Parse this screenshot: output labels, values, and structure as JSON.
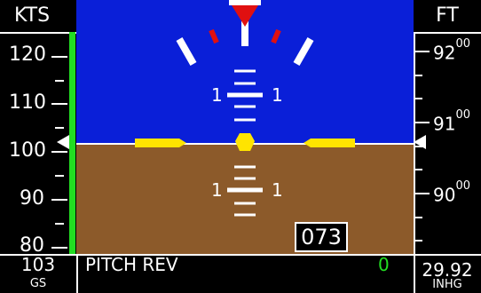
{
  "speed": {
    "unit": "KTS",
    "labels": [
      "120",
      "110",
      "100",
      "90",
      "80"
    ],
    "value": "103",
    "sub": "GS"
  },
  "altitude": {
    "unit": "FT",
    "labels": [
      {
        "hi": "92",
        "lo": "00"
      },
      {
        "hi": "91",
        "lo": "00"
      },
      {
        "hi": "90",
        "lo": "00"
      }
    ],
    "baro_value": "29.92",
    "baro_unit": "INHG"
  },
  "attitude": {
    "pitch_labels_upper": [
      "1",
      "1"
    ],
    "pitch_labels_lower": [
      "1",
      "1"
    ],
    "heading": "073"
  },
  "mode": {
    "text": "PITCH REV",
    "value": "0"
  },
  "colors": {
    "sky": "#0a1fd8",
    "ground": "#8c5a2a",
    "symbol": "#ffe400",
    "trend": "#22dd22",
    "roll_red": "#e01010",
    "mode_value": "#22dd22"
  }
}
